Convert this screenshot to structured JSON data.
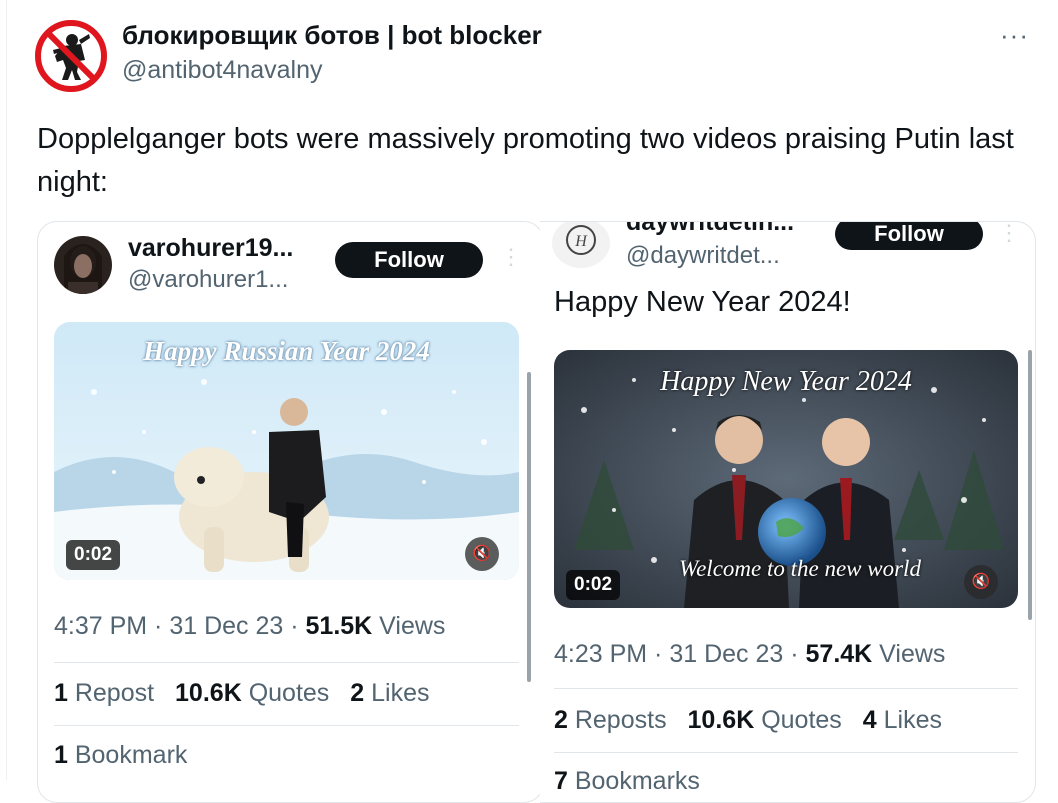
{
  "tweet": {
    "author_name": "блокировщик ботов | bot blocker",
    "author_handle": "@antibot4navalny",
    "more_label": "···",
    "text": "Dopplelganger bots were massively promoting two videos praising Putin last night:",
    "avatar_icon": "no-bots-sign-icon"
  },
  "embed_left": {
    "name": "varohurer19...",
    "handle": "@varohurer1...",
    "follow_label": "Follow",
    "kebab": "⋮",
    "video": {
      "overlay_title": "Happy Russian Year 2024",
      "duration": "0:02",
      "mute_icon": "🔇"
    },
    "meta": {
      "time": "4:37 PM · 31 Dec 23 · ",
      "views_count": "51.5K",
      "views_label": " Views"
    },
    "stats": {
      "reposts_count": "1",
      "reposts_label": " Repost",
      "quotes_count": "10.6K",
      "quotes_label": " Quotes",
      "likes_count": "2",
      "likes_label": " Likes"
    },
    "bookmarks": {
      "count": "1",
      "label": " Bookmark"
    }
  },
  "embed_right": {
    "name": "daywritdetin...",
    "handle": "@daywritdet...",
    "follow_label": "Follow",
    "kebab": "⋮",
    "text": "Happy New Year 2024!",
    "video": {
      "overlay_title": "Happy New Year 2024",
      "overlay_caption": "Welcome to the new world",
      "duration": "0:02",
      "mute_icon": "🔇"
    },
    "meta": {
      "time": "4:23 PM · 31 Dec 23 · ",
      "views_count": "57.4K",
      "views_label": " Views"
    },
    "stats": {
      "reposts_count": "2",
      "reposts_label": " Reposts",
      "quotes_count": "10.6K",
      "quotes_label": " Quotes",
      "likes_count": "4",
      "likes_label": " Likes"
    },
    "bookmarks": {
      "count": "7",
      "label": " Bookmarks"
    }
  },
  "colors": {
    "text": "#0f1419",
    "muted": "#536471",
    "button": "#0f1419",
    "border": "#e1e6ea",
    "no_sign": "#e0161e"
  }
}
